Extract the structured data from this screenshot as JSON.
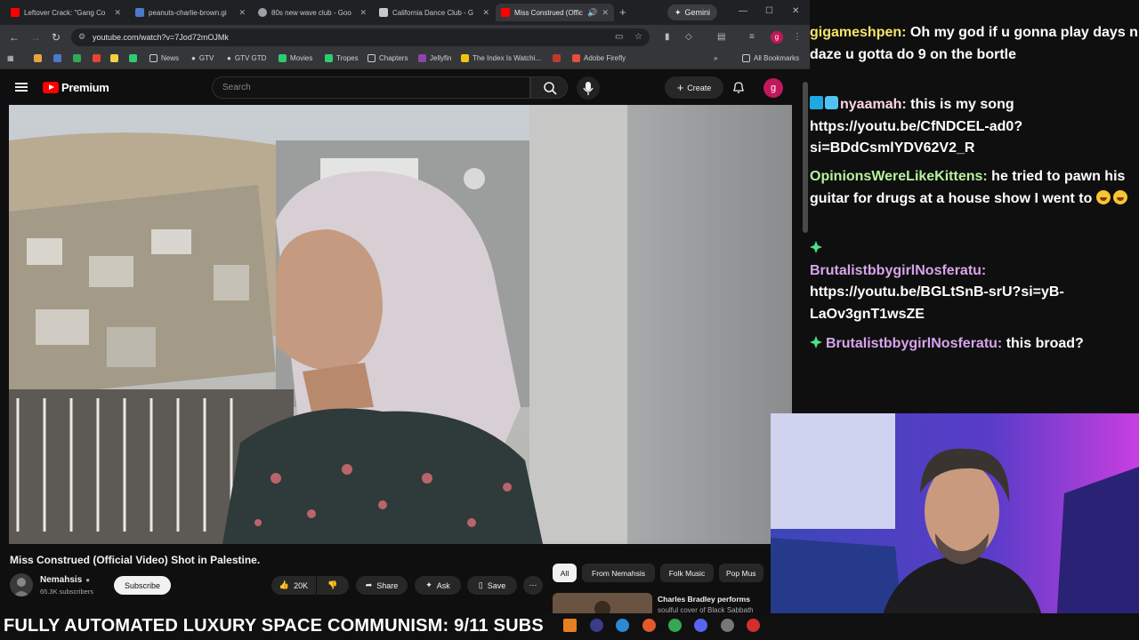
{
  "browser": {
    "tabs": [
      {
        "label": "Leftover Crack: \"Gang Co",
        "active": false,
        "favicon": "youtube-icon"
      },
      {
        "label": "peanuts-charlie-brown.gi",
        "active": false,
        "favicon": "image-icon"
      },
      {
        "label": "80s new wave club - Goo",
        "active": false,
        "favicon": "google-icon"
      },
      {
        "label": "California Dance Club - G",
        "active": false,
        "favicon": "document-icon"
      },
      {
        "label": "Miss Construed (Offic",
        "active": true,
        "favicon": "youtube-icon"
      }
    ],
    "gemini_label": "Gemini",
    "url": "youtube.com/watch?v=7Jod72mOJMk",
    "bookmarks": [
      "News",
      "GTV",
      "GTV GTD",
      "Movies",
      "Tropes",
      "Chapters",
      "Jellyfin",
      "The Index Is Watchi...",
      "Adobe Firefly"
    ],
    "all_bookmarks": "All Bookmarks",
    "profile_letter": "g"
  },
  "youtube": {
    "brand": "Premium",
    "search_placeholder": "Search",
    "create_label": "Create",
    "avatar_letter": "g",
    "video_title": "Miss Construed (Official Video) Shot in Palestine.",
    "channel_name": "Nemahsis",
    "channel_subs": "65.3K subscribers",
    "subscribe_label": "Subscribe",
    "like_count": "20K",
    "share_label": "Share",
    "ask_label": "Ask",
    "save_label": "Save",
    "chips": [
      "All",
      "From Nemahsis",
      "Folk Music",
      "Pop Mus"
    ],
    "rec_title": "Charles Bradley performs",
    "rec_subtitle": "soulful cover of Black Sabbath"
  },
  "chat": [
    {
      "user": "gigameshpen:",
      "text": " Oh my god if u gonna play days n daze u gotta do 9 on the bortle",
      "color": "#f6e46a",
      "badges": []
    },
    {
      "user": "nyaamah:",
      "text": " this is my song https://youtu.be/CfNDCEL-ad0?si=BDdCsmlYDV62V2_R",
      "color": "#ffd7e6",
      "badges": [
        "grid-badge-icon",
        "cube-badge-icon"
      ]
    },
    {
      "user": "OpinionsWereLikeKittens:",
      "text": " he tried to pawn his guitar for drugs at a house show I went to",
      "color": "#b6f39e",
      "badges": []
    },
    {
      "user": "BrutalistbbygirlNosferatu:",
      "text": " https://youtu.be/BGLtSnB-srU?si=yB-LaOv3gnT1wsZE",
      "color": "#d8a4ec",
      "badges": [
        "sparkle-icon"
      ]
    },
    {
      "user": "BrutalistbbygirlNosferatu:",
      "text": " this broad?",
      "color": "#d8a4ec",
      "badges": [
        "sparkle-icon"
      ]
    }
  ],
  "ticker": "FULLY AUTOMATED LUXURY SPACE COMMUNISM: 9/11 SUBS",
  "colors": {
    "youtube_red": "#ff0000",
    "profile_pink": "#c2185b",
    "gemini_bg": "#3c3d40"
  }
}
